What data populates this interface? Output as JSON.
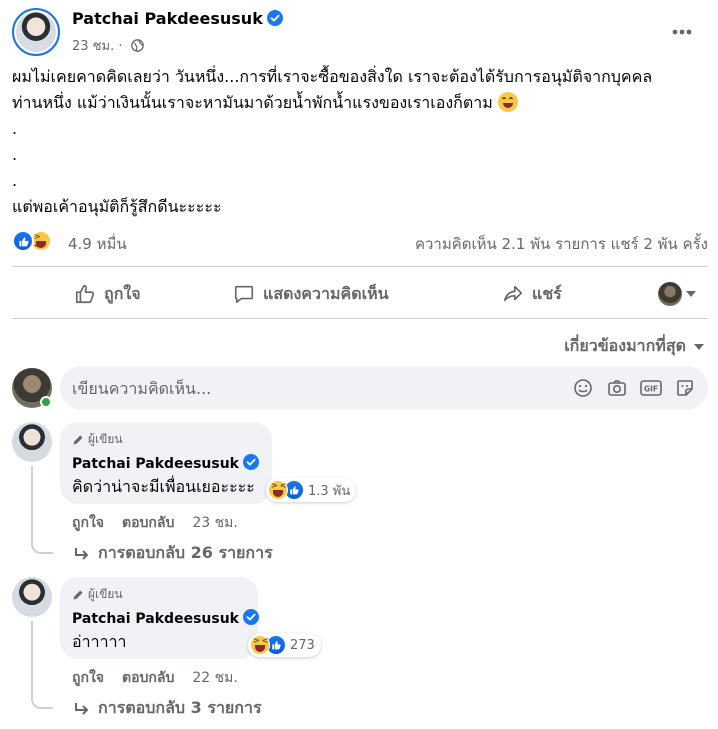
{
  "post": {
    "author": "Patchai Pakdeesusuk",
    "time": "23 ชม.",
    "separator": "·",
    "more_icon": "more-horizontal-icon",
    "text_lines": [
      "ผมไม่เคยคาดคิดเลยว่า วันหนึ่ง...การที่เราจะซื้อของสิ่งใด เราจะต้องได้รับการอนุมัติจากบุคคล",
      "ท่านหนึ่ง แม้ว่าเงินนั้นเราจะหามันมาด้วยน้ำพักน้ำแรงของเราเองก็ตาม",
      ".",
      ".",
      ".",
      "แต่พอเค้าอนุมัติก็รู้สึกดีนะะะะะ"
    ]
  },
  "stats": {
    "reaction_count": "4.9 หมื่น",
    "comments_shares": "ความคิดเห็น 2.1 พัน รายการ  แชร์ 2 พัน ครั้ง"
  },
  "actions": {
    "like": "ถูกใจ",
    "comment": "แสดงความคิดเห็น",
    "share": "แชร์"
  },
  "sort_label": "เกี่ยวข้องมากที่สุด",
  "composer": {
    "placeholder": "เขียนความคิดเห็น..."
  },
  "comments": [
    {
      "badge": "ผู้เขียน",
      "author": "Patchai Pakdeesusuk",
      "text": "คิดว่าน่าจะมีเพื่อนเยอะะะะ",
      "reaction_count": "1.3 พัน",
      "like": "ถูกใจ",
      "reply": "ตอบกลับ",
      "time": "23 ชม.",
      "replies": "การตอบกลับ 26 รายการ"
    },
    {
      "badge": "ผู้เขียน",
      "author": "Patchai Pakdeesusuk",
      "text": "อ่าาาาา",
      "reaction_count": "273",
      "like": "ถูกใจ",
      "reply": "ตอบกลับ",
      "time": "22 ชม.",
      "replies": "การตอบกลับ 3 รายการ"
    }
  ],
  "colors": {
    "brand_blue": "#1877f2",
    "secondary_text": "#65676b",
    "bubble_bg": "#f0f2f5",
    "online_green": "#31a24c"
  }
}
